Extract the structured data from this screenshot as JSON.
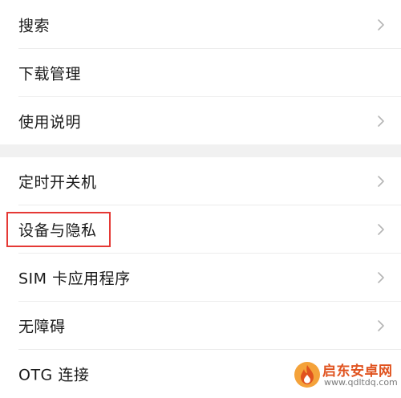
{
  "settings_group_1": {
    "items": [
      {
        "label": "搜索"
      },
      {
        "label": "下载管理"
      },
      {
        "label": "使用说明"
      }
    ]
  },
  "settings_group_2": {
    "items": [
      {
        "label": "定时开关机"
      },
      {
        "label": "设备与隐私"
      },
      {
        "label": "SIM 卡应用程序"
      },
      {
        "label": "无障碍"
      },
      {
        "label": "OTG 连接"
      }
    ]
  },
  "annotation": {
    "highlight_color": "#e53935",
    "highlighted_item": "设备与隐私"
  },
  "watermark": {
    "title": "启东安卓网",
    "url": "www.qdltdq.com",
    "icon": "flame-logo-icon",
    "brand_color": "#e0531f"
  },
  "icons": {
    "row_chevron": "chevron-right-icon"
  }
}
